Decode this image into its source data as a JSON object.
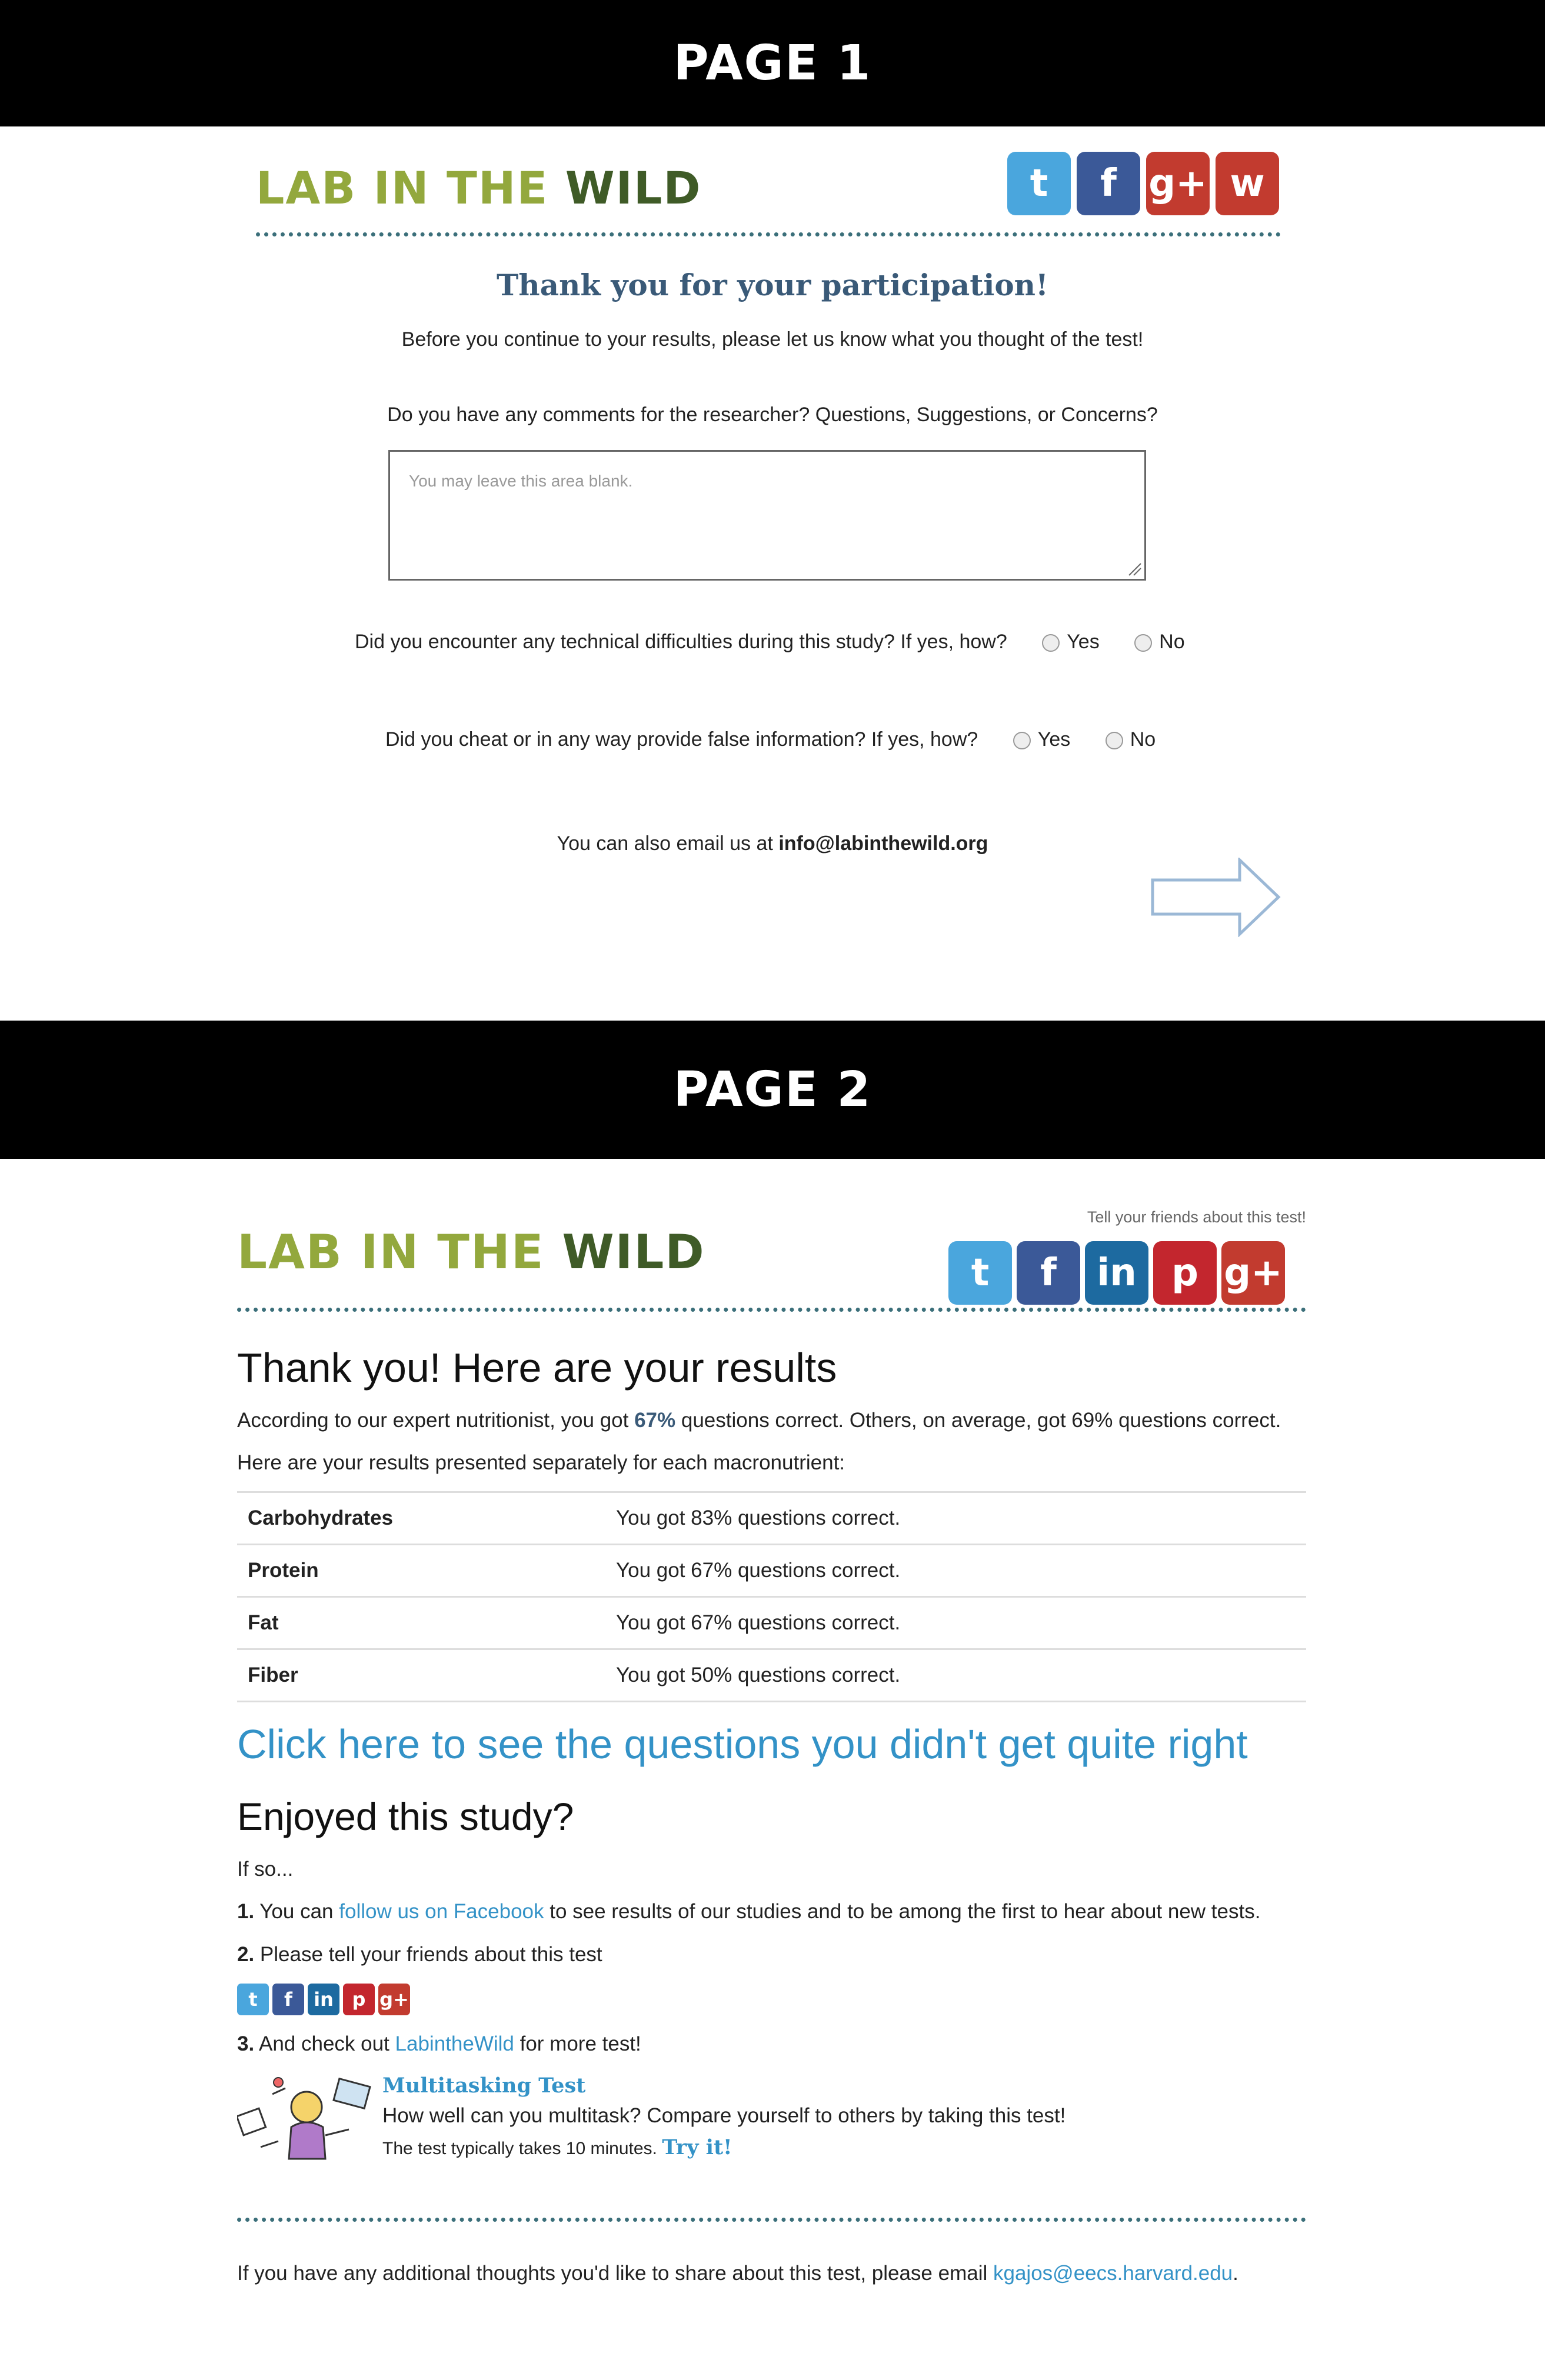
{
  "page1": {
    "banner": "PAGE 1",
    "logo": {
      "part1": "LAB IN THE ",
      "part2": "WILD"
    },
    "social_icons": [
      "twitter-icon",
      "facebook-icon",
      "google-plus-icon",
      "weibo-icon"
    ],
    "title": "Thank you for your participation!",
    "intro": "Before you continue to your results, please let us know what you thought of the test!",
    "comments_question": "Do you have any comments for the researcher? Questions, Suggestions, or Concerns?",
    "comments_placeholder": "You may leave this area blank.",
    "q_technical": "Did you encounter any technical difficulties during this study? If yes, how?",
    "q_cheat": "Did you cheat or in any way provide false information? If yes, how?",
    "yes_label": "Yes",
    "no_label": "No",
    "email_prefix": "You can also email us at ",
    "email": "info@labinthewild.org"
  },
  "page2": {
    "banner": "PAGE 2",
    "logo": {
      "part1": "LAB IN THE ",
      "part2": "WILD"
    },
    "share_caption": "Tell your friends about this test!",
    "social_icons": [
      "twitter-icon",
      "facebook-icon",
      "linkedin-icon",
      "pinterest-icon",
      "google-plus-icon"
    ],
    "heading": "Thank you! Here are your results",
    "summary_prefix": "According to our expert nutritionist, you got ",
    "summary_score": "67%",
    "summary_suffix": " questions correct. Others, on average, got 69% questions correct.",
    "separately": "Here are your results presented separately for each macronutrient:",
    "results": [
      {
        "name": "Carbohydrates",
        "value": "You got 83% questions correct."
      },
      {
        "name": "Protein",
        "value": "You got 67% questions correct."
      },
      {
        "name": "Fat",
        "value": "You got 67% questions correct."
      },
      {
        "name": "Fiber",
        "value": "You got 50% questions correct."
      }
    ],
    "questions_link": "Click here to see the questions you didn't get quite right",
    "enjoyed_heading": "Enjoyed this study?",
    "if_so": "If so...",
    "step1_num": "1.",
    "step1_prefix": " You can ",
    "step1_link": "follow us on Facebook",
    "step1_suffix": " to see results of our studies and to be among the first to hear about new tests.",
    "step2_num": "2.",
    "step2_text": " Please tell your friends about this test",
    "step3_num": "3.",
    "step3_prefix": " And check out ",
    "step3_link": "LabintheWild",
    "step3_suffix": " for more test!",
    "promo": {
      "title": "Multitasking Test",
      "desc": "How well can you multitask? Compare yourself to others by taking this test!",
      "time": "The test typically takes 10 minutes.",
      "cta": "Try it!"
    },
    "footer_prefix": "If you have any additional thoughts you'd like to share about this test, please email ",
    "footer_email": "kgajos@eecs.harvard.edu",
    "footer_suffix": "."
  },
  "colors": {
    "title_blue": "#3a5a78",
    "link_blue": "#3392c7",
    "logo_light": "#93a83d",
    "logo_dark": "#3f5b27",
    "divider": "#3b6f7a"
  }
}
